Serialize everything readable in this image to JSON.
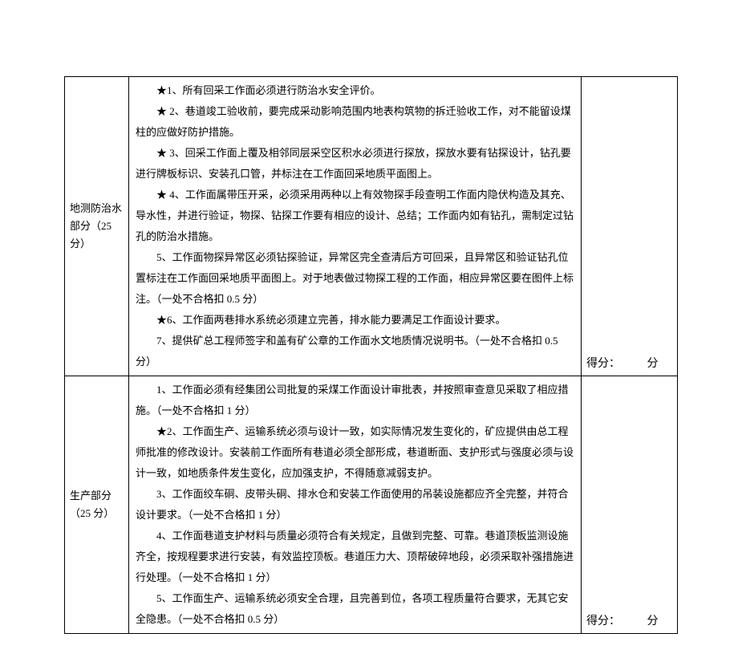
{
  "rows": [
    {
      "label": "地测防治水部分（25 分）",
      "items": [
        "★1、所有回采工作面必须进行防治水安全评价。",
        "★ 2、巷道竣工验收前，要完成采动影响范围内地表构筑物的拆迁验收工作，对不能留设煤柱的应做好防护措施。",
        "★ 3、回采工作面上覆及相邻同层采空区积水必须进行探放，探放水要有钻探设计，钻孔要进行牌板标识、安装孔口管，并标注在工作面回采地质平面图上。",
        "★ 4、工作面属带压开采，必须采用两种以上有效物探手段查明工作面内隐伏构造及其充、导水性，并进行验证，物探、钻探工作要有相应的设计、总结；工作面内如有钻孔，需制定过钻孔的防治水措施。",
        "5、工作面物探异常区必须钻探验证，异常区完全查清后方可回采，且异常区和验证钻孔位置标注在工作面回采地质平面图上。对于地表做过物探工程的工作面，相应异常区要在图件上标注。（一处不合格扣 0.5 分）",
        "★6、工作面两巷排水系统必须建立完善，排水能力要满足工作面设计要求。",
        "7、提供矿总工程师签字和盖有矿公章的工作面水文地质情况说明书。（一处不合格扣 0.5 分）"
      ],
      "score_label": "得分：",
      "score_unit": "分"
    },
    {
      "label": "生产部分（25 分）",
      "items": [
        "1、工作面必须有经集团公司批复的采煤工作面设计审批表，并按照审查意见采取了相应措施。（一处不合格扣 1 分）",
        "★2、工作面生产、运输系统必须与设计一致，如实际情况发生变化的，矿应提供由总工程师批准的修改设计。安装前工作面所有巷道必须全部形成，巷道断面、支护形式与强度必须与设计一致，如地质条件发生变化，应加强支护，不得随意减弱支护。",
        "3、工作面绞车硐、皮带头硐、排水仓和安装工作面使用的吊装设施都应齐全完整，并符合设计要求。（一处不合格扣 1 分）",
        "4、工作面巷道支护材料与质量必须符合有关规定，且做到完整、可靠。巷道顶板监测设施齐全，按规程要求进行安装，有效监控顶板。巷道压力大、顶帮破碎地段，必须采取补强措施进行处理。（一处不合格扣 1 分）",
        "5、工作面生产、运输系统必须安全合理，且完善到位，各项工程质量符合要求，无其它安全隐患。（一处不合格扣 0.5 分）"
      ],
      "score_label": "得分：",
      "score_unit": "分"
    }
  ]
}
